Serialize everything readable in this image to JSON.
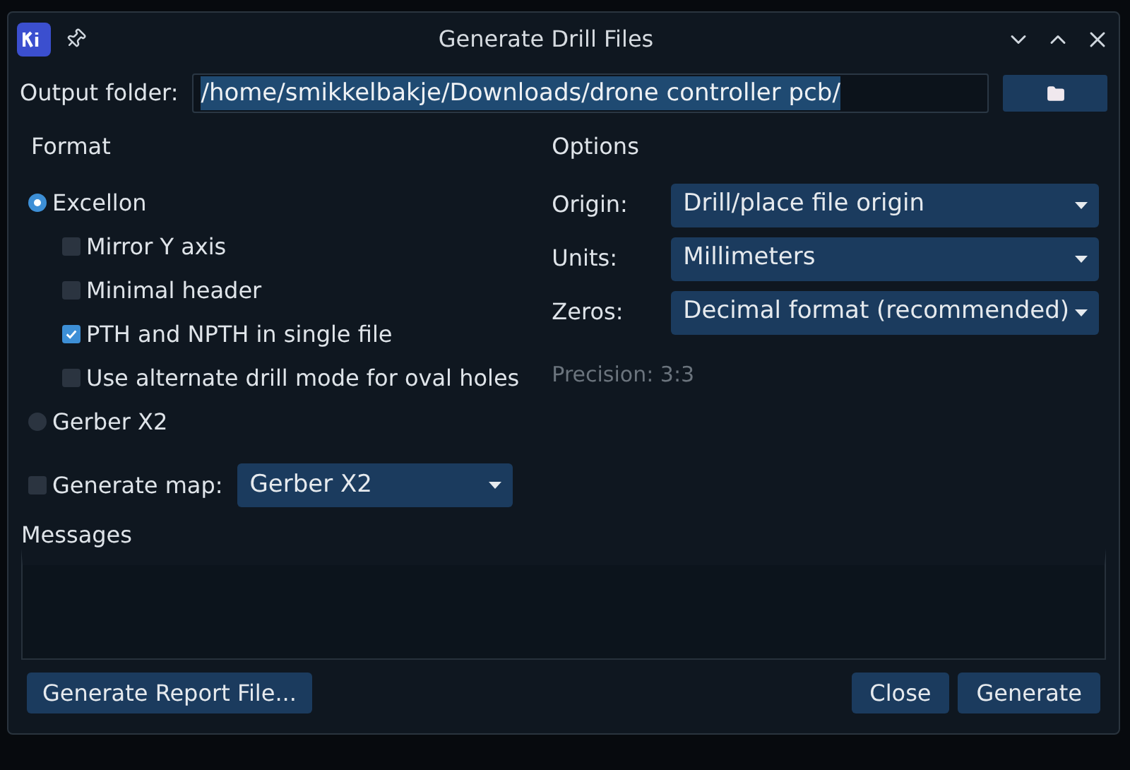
{
  "window": {
    "title": "Generate Drill Files"
  },
  "output_folder": {
    "label": "Output folder:",
    "value": "/home/smikkelbakje/Downloads/drone controller pcb/"
  },
  "format": {
    "title": "Format",
    "radios": [
      {
        "label": "Excellon",
        "selected": true,
        "suboptions": [
          {
            "label": "Mirror Y axis",
            "checked": false
          },
          {
            "label": "Minimal header",
            "checked": false
          },
          {
            "label": "PTH and NPTH in single file",
            "checked": true
          },
          {
            "label": "Use alternate drill mode for oval holes",
            "checked": false
          }
        ]
      },
      {
        "label": "Gerber X2",
        "selected": false
      }
    ]
  },
  "generate_map": {
    "label": "Generate map:",
    "checked": false,
    "value": "Gerber X2"
  },
  "options": {
    "title": "Options",
    "fields": [
      {
        "label": "Origin:",
        "value": "Drill/place file origin"
      },
      {
        "label": "Units:",
        "value": "Millimeters"
      },
      {
        "label": "Zeros:",
        "value": "Decimal format (recommended)"
      }
    ],
    "precision": "Precision: 3:3"
  },
  "messages": {
    "title": "Messages"
  },
  "footer": {
    "left_buttons": [
      "Generate Report File..."
    ],
    "right_buttons": [
      "Close",
      "Generate"
    ]
  }
}
